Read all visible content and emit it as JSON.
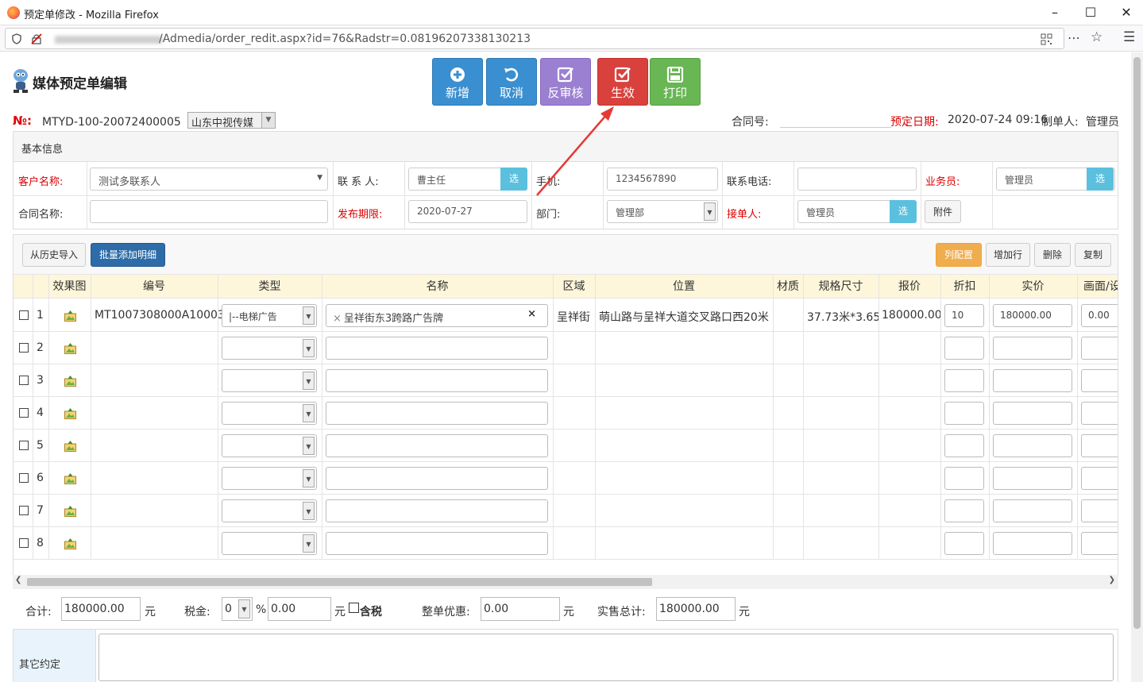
{
  "browser": {
    "window_title": "预定单修改 - Mozilla Firefox",
    "url_path": "/Admedia/order_redit.aspx?id=76&Radstr=0.08196207338130213"
  },
  "header": {
    "title": "媒体预定单编辑",
    "toolbar": [
      {
        "label": "新增",
        "icon": "plus-circle-icon",
        "color": "#3a8fd0"
      },
      {
        "label": "取消",
        "icon": "undo-icon",
        "color": "#3a8fd0"
      },
      {
        "label": "反审核",
        "icon": "check-square-icon",
        "color": "#9b7fd1"
      },
      {
        "label": "生效",
        "icon": "check-square-icon",
        "color": "#d9413d"
      },
      {
        "label": "打印",
        "icon": "save-icon",
        "color": "#68b654"
      }
    ]
  },
  "order": {
    "no_label": "№:",
    "no_value": "MTYD-100-20072400005",
    "org": "山东中视传媒",
    "contract_no_label": "合同号:",
    "contract_no_value": "",
    "date_label": "预定日期:",
    "date_value": "2020-07-24 09:16",
    "maker_label": "制单人:",
    "maker_value": "管理员"
  },
  "basic": {
    "title": "基本信息",
    "customer_label": "客户名称:",
    "customer_value": "测试多联系人",
    "contact_label": "联 系 人:",
    "contact_value": "曹主任",
    "select_label": "选",
    "mobile_label": "手机:",
    "mobile_value": "1234567890",
    "phone_label": "联系电话:",
    "phone_value": "",
    "salesman_label": "业务员:",
    "salesman_value": "管理员",
    "contract_name_label": "合同名称:",
    "contract_name_value": "",
    "publish_label": "发布期限:",
    "publish_value": "2020-07-27",
    "dept_label": "部门:",
    "dept_value": "管理部",
    "receiver_label": "接单人:",
    "receiver_value": "管理员",
    "attach_label": "附件"
  },
  "detail": {
    "buttons": {
      "history": "从历史导入",
      "batch_add": "批量添加明细",
      "columns": "列配置",
      "add_row": "增加行",
      "delete": "删除",
      "copy": "复制"
    },
    "columns": [
      "效果图",
      "编号",
      "类型",
      "名称",
      "区域",
      "位置",
      "材质",
      "规格尺寸",
      "报价",
      "折扣",
      "实价",
      "画面/设"
    ],
    "rows": [
      {
        "n": "1",
        "code": "MT1007308000A10003",
        "type": "|--电梯广告",
        "name": "呈祥街东3跨路广告牌",
        "clear": "×",
        "close": "×",
        "area": "呈祥街",
        "pos": "萌山路与呈祥大道交叉路口西20米",
        "material": "",
        "size": "37.73米*3.65",
        "quote": "180000.00",
        "discount": "10",
        "price": "180000.00",
        "screen": "0.00"
      },
      {
        "n": "2",
        "code": "",
        "type": "",
        "name": "",
        "clear": "",
        "close": "",
        "area": "",
        "pos": "",
        "material": "",
        "size": "",
        "quote": "",
        "discount": "",
        "price": "",
        "screen": ""
      },
      {
        "n": "3",
        "code": "",
        "type": "",
        "name": "",
        "clear": "",
        "close": "",
        "area": "",
        "pos": "",
        "material": "",
        "size": "",
        "quote": "",
        "discount": "",
        "price": "",
        "screen": ""
      },
      {
        "n": "4",
        "code": "",
        "type": "",
        "name": "",
        "clear": "",
        "close": "",
        "area": "",
        "pos": "",
        "material": "",
        "size": "",
        "quote": "",
        "discount": "",
        "price": "",
        "screen": ""
      },
      {
        "n": "5",
        "code": "",
        "type": "",
        "name": "",
        "clear": "",
        "close": "",
        "area": "",
        "pos": "",
        "material": "",
        "size": "",
        "quote": "",
        "discount": "",
        "price": "",
        "screen": ""
      },
      {
        "n": "6",
        "code": "",
        "type": "",
        "name": "",
        "clear": "",
        "close": "",
        "area": "",
        "pos": "",
        "material": "",
        "size": "",
        "quote": "",
        "discount": "",
        "price": "",
        "screen": ""
      },
      {
        "n": "7",
        "code": "",
        "type": "",
        "name": "",
        "clear": "",
        "close": "",
        "area": "",
        "pos": "",
        "material": "",
        "size": "",
        "quote": "",
        "discount": "",
        "price": "",
        "screen": ""
      },
      {
        "n": "8",
        "code": "",
        "type": "",
        "name": "",
        "clear": "",
        "close": "",
        "area": "",
        "pos": "",
        "material": "",
        "size": "",
        "quote": "",
        "discount": "",
        "price": "",
        "screen": ""
      }
    ]
  },
  "totals": {
    "sum_label": "合计:",
    "sum_value": "180000.00",
    "yuan": "元",
    "tax_label": "税金:",
    "tax_rate": "0",
    "percent": "%",
    "tax_value": "0.00",
    "tax_incl_label": "含税",
    "discount_label": "整单优惠:",
    "discount_value": "0.00",
    "actual_label": "实售总计:",
    "actual_value": "180000.00"
  },
  "other": {
    "label": "其它约定",
    "value": ""
  }
}
